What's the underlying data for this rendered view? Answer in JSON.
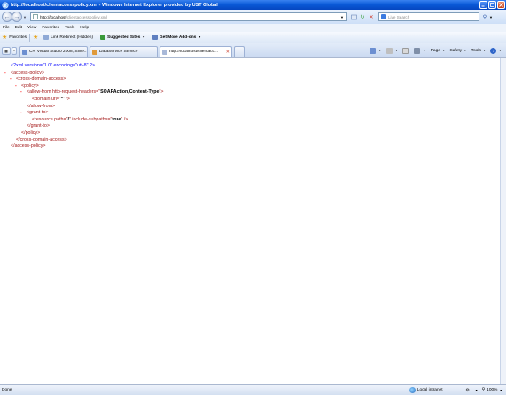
{
  "window": {
    "title": "http://localhost/clientaccesspolicy.xml - Windows Internet Explorer provided by UST Global"
  },
  "address_bar": {
    "url_host": "http://localhost",
    "url_path": "/clientaccesspolicy.xml",
    "search_placeholder": "Live Search"
  },
  "menu": {
    "items": [
      "File",
      "Edit",
      "View",
      "Favorites",
      "Tools",
      "Help"
    ]
  },
  "favorites_bar": {
    "favorites_label": "Favorites",
    "items": [
      {
        "label": "Link Redirect (Hidden)",
        "bold": false
      },
      {
        "label": "Suggested Sites",
        "bold": true
      },
      {
        "label": "Get More Add-ons",
        "bold": true
      }
    ]
  },
  "tabs": [
    {
      "label": "C#, Visual Studio 2008, Silve...",
      "active": false
    },
    {
      "label": "DataService Service",
      "active": false
    },
    {
      "label": "http://localhost/clientacc...",
      "active": true
    }
  ],
  "command_bar": {
    "page_label": "Page",
    "safety_label": "Safety",
    "tools_label": "Tools",
    "help_glyph": "?"
  },
  "xml_document": {
    "declaration": "<?xml version=\"1.0\" encoding=\"utf-8\" ?>",
    "collapse_glyph": "-",
    "lines": [
      {
        "text": "<access-policy>",
        "has_minus": true
      },
      {
        "text": "<cross-domain-access>",
        "has_minus": true
      },
      {
        "text": "<policy>",
        "has_minus": true
      },
      {
        "pre": "<allow-from http-request-headers=\"",
        "bold": "SOAPAction,Content-Type",
        "post": "\">",
        "has_minus": true
      },
      {
        "pre": "<domain uri=\"",
        "bold": "*",
        "post": "\" />",
        "has_minus": false
      },
      {
        "text": "</allow-from>",
        "has_minus": false
      },
      {
        "text": "<grant-to>",
        "has_minus": true
      },
      {
        "pre": "<resource path=\"",
        "bold": "/",
        "mid": "\" include-subpaths=\"",
        "bold2": "true",
        "post": "\" />",
        "has_minus": false
      },
      {
        "text": "</grant-to>",
        "has_minus": false
      },
      {
        "text": "</policy>",
        "has_minus": false
      },
      {
        "text": "</cross-domain-access>",
        "has_minus": false
      },
      {
        "text": "</access-policy>",
        "has_minus": false
      }
    ]
  },
  "status_bar": {
    "status_text": "Done",
    "zone": "Local intranet",
    "zoom": "100%"
  }
}
